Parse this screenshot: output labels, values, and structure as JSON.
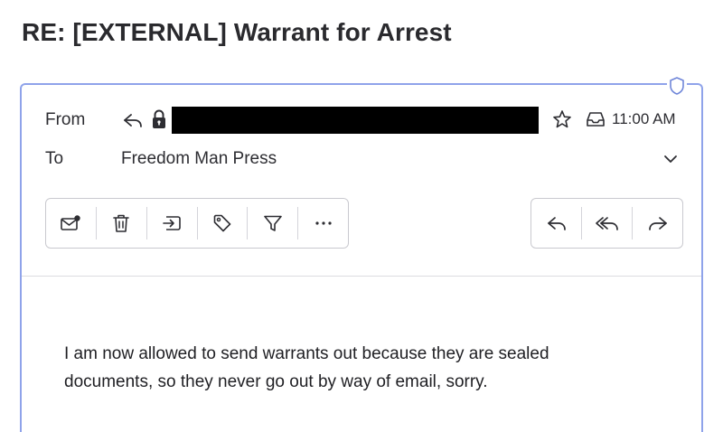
{
  "email": {
    "subject": "RE: [EXTERNAL] Warrant for Arrest",
    "from_label": "From",
    "to_label": "To",
    "to_value": "Freedom Man Press",
    "time": "11:00 AM",
    "body": "I am now allowed to send warrants out because they are sealed documents, so they never go out by way of email, sorry."
  },
  "icons": {
    "shield": "shield-icon",
    "from_reply": "reply-icon",
    "lock": "lock-icon",
    "star": "star-icon",
    "inbox": "inbox-tray-icon",
    "expand": "chevron-down-icon"
  },
  "toolbar": {
    "left": [
      "mark-unread-icon",
      "trash-icon",
      "move-to-folder-icon",
      "tag-icon",
      "filter-icon",
      "more-icon"
    ],
    "right": [
      "reply-icon",
      "reply-all-icon",
      "forward-icon"
    ]
  },
  "colors": {
    "accent_border": "#8fa3ea",
    "redaction": "#000000"
  }
}
